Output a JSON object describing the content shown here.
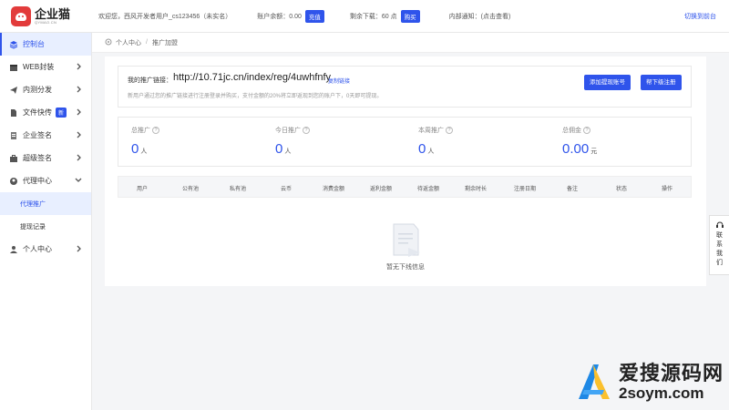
{
  "header": {
    "logo_cn": "企业猫",
    "logo_en": "QYMAO.CN",
    "welcome": "欢迎您，西风开发者用户_cs123456（未实名）",
    "balance_label": "账户余额：0.00",
    "recharge_btn": "充值",
    "downloads_label": "剩余下载：60 点",
    "buy_btn": "购买",
    "notice": "内部通知：(点击查看)",
    "switch_front": "切换到前台"
  },
  "sidebar": {
    "items": [
      {
        "label": "控制台",
        "icon": "layers-icon"
      },
      {
        "label": "WEB封装",
        "icon": "box-icon"
      },
      {
        "label": "内测分发",
        "icon": "send-icon"
      },
      {
        "label": "文件快传",
        "icon": "file-icon",
        "badge": "新"
      },
      {
        "label": "企业签名",
        "icon": "document-icon"
      },
      {
        "label": "超级签名",
        "icon": "briefcase-icon"
      },
      {
        "label": "代理中心",
        "icon": "agent-icon"
      },
      {
        "label": "代理推广"
      },
      {
        "label": "提现记录"
      },
      {
        "label": "个人中心",
        "icon": "user-icon"
      }
    ]
  },
  "breadcrumb": {
    "home": "个人中心",
    "separator": "/",
    "current": "推广加盟"
  },
  "promo": {
    "label": "我的推广链接：",
    "url": "http://10.71jc.cn/index/reg/4uwhfnfy",
    "copy": "复制链接",
    "desc": "新用户通过您的推广链接进行注册登录并购买，支付金额的20%将立即返现到您的账户下，0天即可提现。",
    "btn_add": "添加提现账号",
    "btn_register": "帮下级注册"
  },
  "stats": [
    {
      "label": "总推广",
      "value": "0",
      "unit": "人"
    },
    {
      "label": "今日推广",
      "value": "0",
      "unit": "人"
    },
    {
      "label": "本周推广",
      "value": "0",
      "unit": "人"
    },
    {
      "label": "总佣金",
      "value": "0.00",
      "unit": "元"
    }
  ],
  "table": {
    "headers": [
      "用户",
      "公有池",
      "私有池",
      "云币",
      "消费金额",
      "返利金额",
      "待返金额",
      "剩余时长",
      "注册日期",
      "备注",
      "状态",
      "操作"
    ]
  },
  "empty_text": "暂无下线信息",
  "float_contact": {
    "chars": [
      "联",
      "系",
      "我",
      "们"
    ]
  },
  "watermark": {
    "cn": "爱搜源码网",
    "en": "2soym.com"
  },
  "colors": {
    "primary": "#2f54eb",
    "logo_red": "#e23b3b"
  }
}
